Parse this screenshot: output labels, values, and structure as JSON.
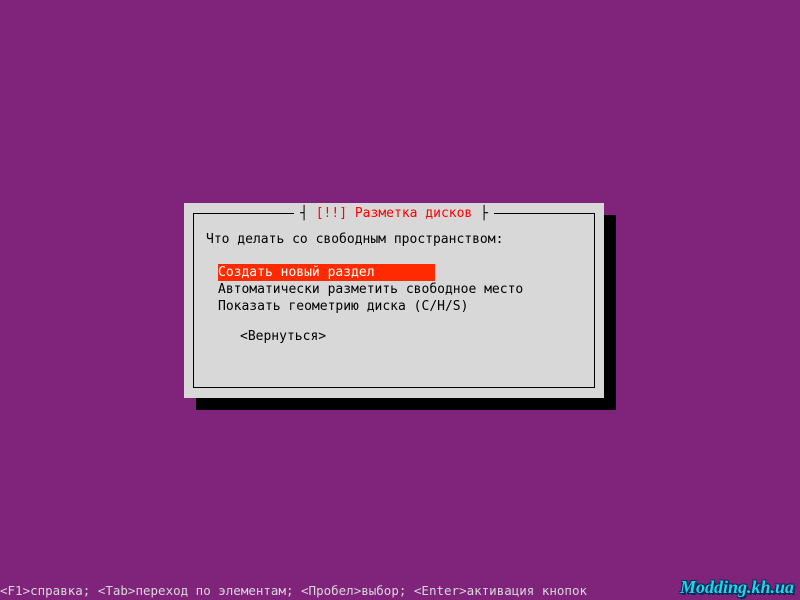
{
  "dialog": {
    "title_brace_l": "┤",
    "title_mark": " [!!] ",
    "title_text": "Разметка дисков",
    "title_brace_r": " ├",
    "question": "Что делать со свободным пространством:",
    "options": [
      {
        "label": "Создать новый раздел",
        "selected": true
      },
      {
        "label": "Автоматически разметить свободное место",
        "selected": false
      },
      {
        "label": "Показать геометрию диска (C/H/S)",
        "selected": false
      }
    ],
    "back": "<Вернуться>"
  },
  "hints": "<F1>справка; <Tab>переход по элементам; <Пробел>выбор; <Enter>активация кнопок",
  "watermark": "Modding.kh.ua"
}
